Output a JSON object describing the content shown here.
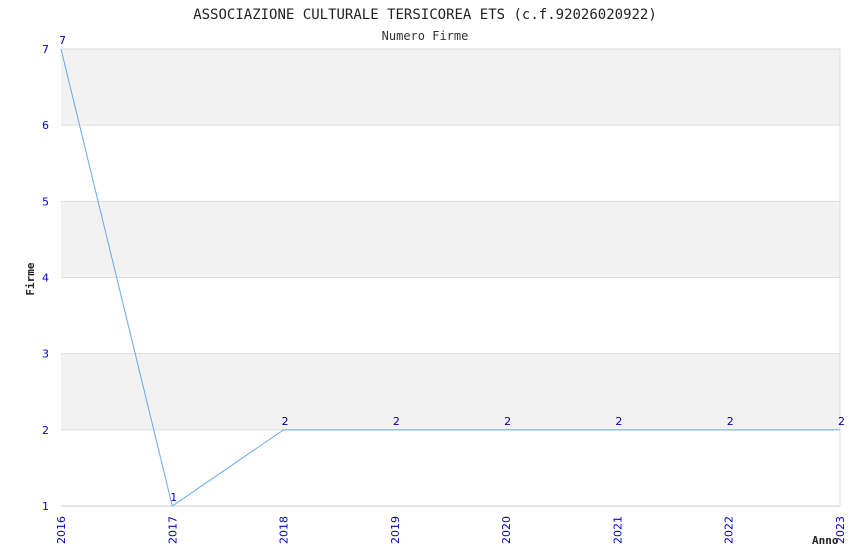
{
  "chart_data": {
    "type": "line",
    "title": "ASSOCIAZIONE CULTURALE TERSICOREA ETS (c.f.92026020922)",
    "subtitle": "Numero Firme",
    "xlabel": "Anno",
    "ylabel": "Firme",
    "x": [
      "2016",
      "2017",
      "2018",
      "2019",
      "2020",
      "2021",
      "2022",
      "2023"
    ],
    "values": [
      7,
      1,
      2,
      2,
      2,
      2,
      2,
      2
    ],
    "ylim": [
      1,
      7
    ],
    "yticks": [
      1,
      2,
      3,
      4,
      5,
      6,
      7
    ],
    "grid": true,
    "band_color": "#f2f2f2",
    "grid_color": "#dddddd",
    "line_color": "#66aaee",
    "tick_color": "#0000cc"
  }
}
